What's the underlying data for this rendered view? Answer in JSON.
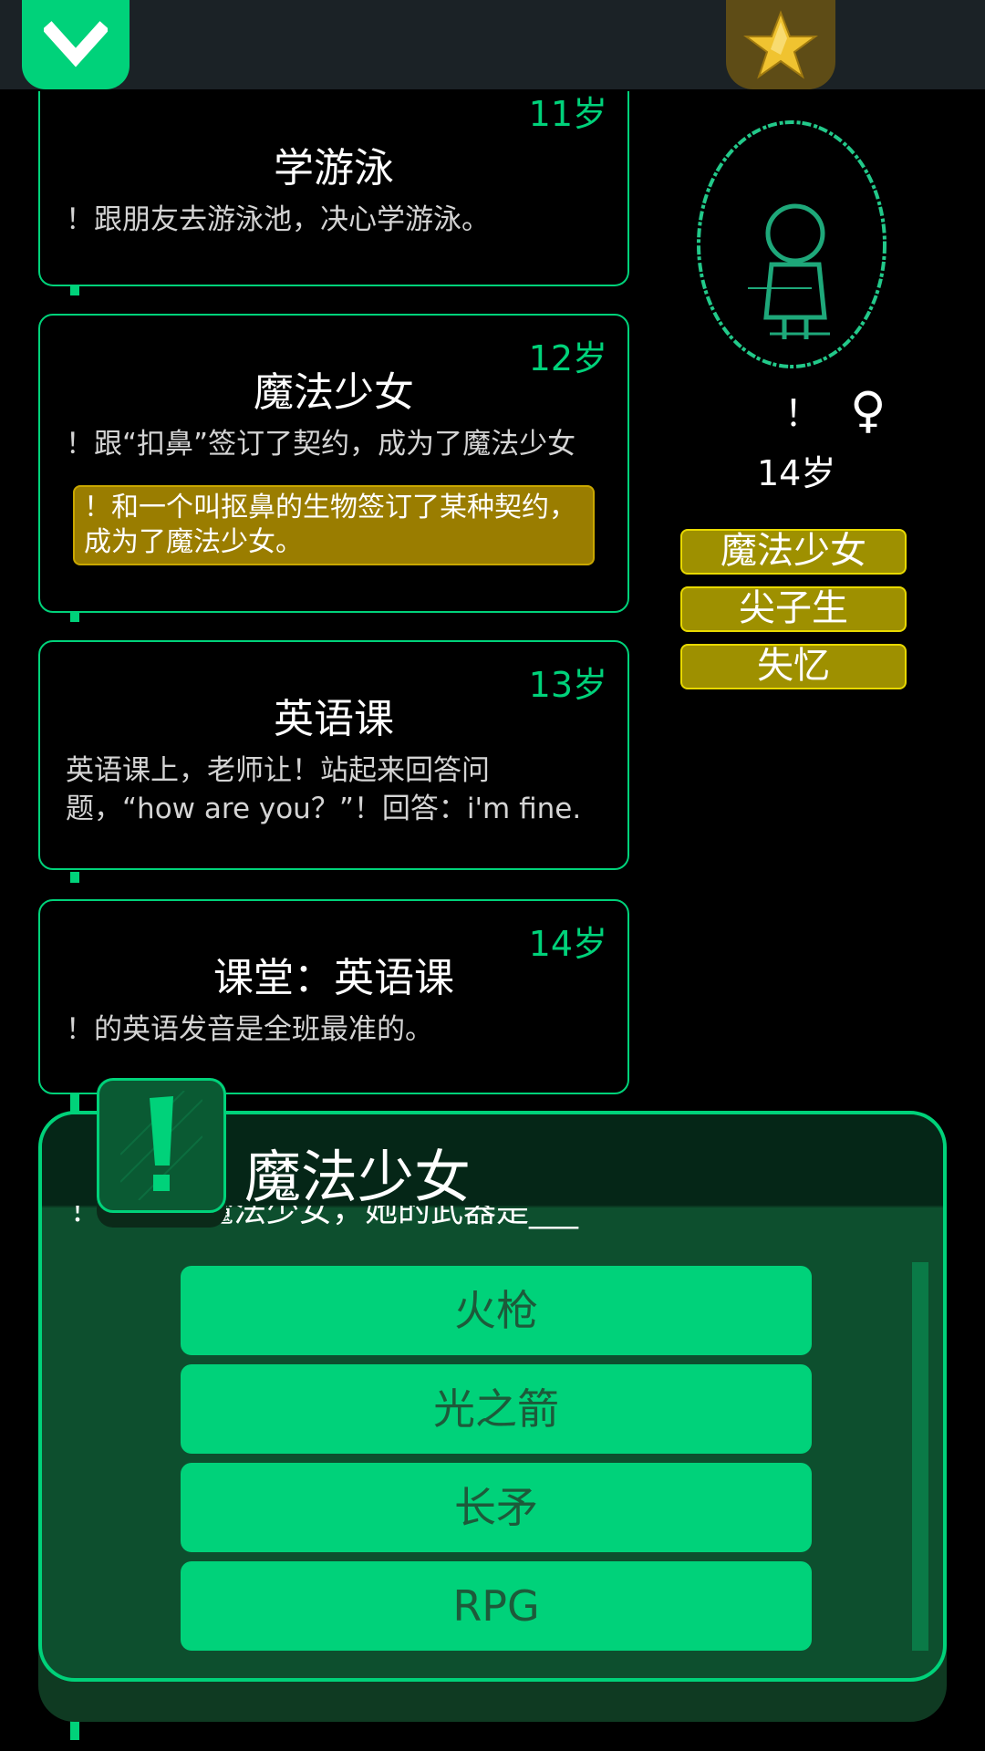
{
  "topbar": {
    "collapse_icon": "chevron-down-icon",
    "star_icon": "star-icon"
  },
  "timeline": [
    {
      "age": "11岁",
      "title": "学游泳",
      "desc": "！跟朋友去游泳池，决心学游泳。"
    },
    {
      "age": "12岁",
      "title": "魔法少女",
      "desc": "！跟“扣鼻”签订了契约，成为了魔法少女",
      "note": "！和一个叫抠鼻的生物签订了某种契约，成为了魔法少女。"
    },
    {
      "age": "13岁",
      "title": "英语课",
      "desc": "英语课上，老师让！站起来回答问题，“how are you？”！回答：i'm fine."
    },
    {
      "age": "14岁",
      "title": "课堂：英语课",
      "desc": "！的英语发音是全班最准的。"
    }
  ],
  "profile": {
    "name": "！",
    "gender_symbol": "♀",
    "age": "14岁",
    "tags": [
      "魔法少女",
      "尖子生",
      "失忆"
    ]
  },
  "dialog": {
    "title": "魔法少女",
    "question": "！是一位魔法少女，她的武器是___",
    "options": [
      "火枪",
      "光之箭",
      "长矛",
      "RPG"
    ]
  },
  "colors": {
    "accent": "#00d27a",
    "tag_bg": "#9e9000",
    "note_bg": "#9a7d00",
    "star_bg": "#5e4c16"
  }
}
